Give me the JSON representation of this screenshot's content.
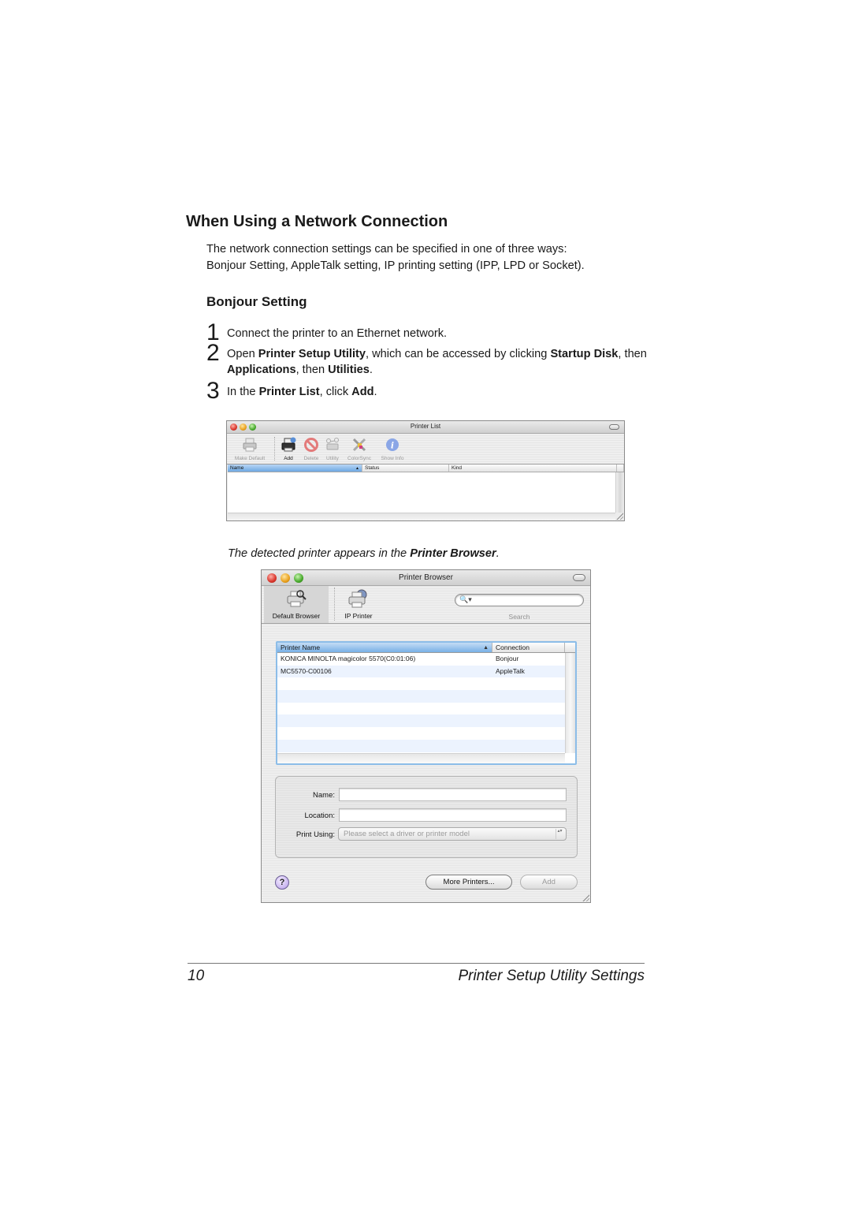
{
  "section_title": "When Using a Network Connection",
  "intro": {
    "line1": "The network connection settings can be specified in one of three ways:",
    "line2": "Bonjour Setting, AppleTalk setting, IP printing setting (IPP, LPD or Socket)."
  },
  "subsection_title": "Bonjour Setting",
  "steps": [
    {
      "num": "1",
      "parts": [
        "Connect the printer to an Ethernet network."
      ]
    },
    {
      "num": "2",
      "parts": [
        "Open ",
        "Printer Setup Utility",
        ", which can be accessed by clicking ",
        "Startup Disk",
        ", then ",
        "Applications",
        ", then ",
        "Utilities",
        "."
      ]
    },
    {
      "num": "3",
      "parts": [
        "In the ",
        "Printer List",
        ", click ",
        "Add",
        "."
      ]
    }
  ],
  "printer_list_window": {
    "title": "Printer List",
    "toolbar": [
      {
        "label": "Make Default",
        "icon": "printer-icon",
        "enabled": false
      },
      {
        "label": "Add",
        "icon": "add-printer-icon",
        "enabled": true
      },
      {
        "label": "Delete",
        "icon": "delete-icon",
        "enabled": false
      },
      {
        "label": "Utility",
        "icon": "utility-icon",
        "enabled": false
      },
      {
        "label": "ColorSync",
        "icon": "colorsync-icon",
        "enabled": false
      },
      {
        "label": "Show Info",
        "icon": "info-icon",
        "enabled": false
      }
    ],
    "columns": [
      "Name",
      "Status",
      "Kind"
    ],
    "sort_indicator": "▲"
  },
  "caption": {
    "pre": "The detected printer appears in the ",
    "bold": "Printer Browser",
    "post": "."
  },
  "printer_browser_window": {
    "title": "Printer Browser",
    "tabs": [
      {
        "label": "Default Browser",
        "icon": "default-browser-icon",
        "active": true
      },
      {
        "label": "IP Printer",
        "icon": "ip-printer-icon",
        "active": false
      }
    ],
    "search_label": "Search",
    "search_icon": "🔍▾",
    "table": {
      "columns": [
        "Printer Name",
        "Connection"
      ],
      "sort_indicator": "▲",
      "rows": [
        {
          "name": "KONICA MINOLTA magicolor 5570(C0:01:06)",
          "connection": "Bonjour"
        },
        {
          "name": "MC5570-C00106",
          "connection": "AppleTalk"
        },
        {
          "name": "",
          "connection": ""
        },
        {
          "name": "",
          "connection": ""
        },
        {
          "name": "",
          "connection": ""
        },
        {
          "name": "",
          "connection": ""
        },
        {
          "name": "",
          "connection": ""
        },
        {
          "name": "",
          "connection": ""
        },
        {
          "name": "",
          "connection": ""
        }
      ]
    },
    "form": {
      "name_label": "Name:",
      "name_value": "",
      "location_label": "Location:",
      "location_value": "",
      "print_using_label": "Print Using:",
      "print_using_value": "Please select a driver or printer model",
      "stepper": "▴▾"
    },
    "help_label": "?",
    "more_printers_label": "More Printers...",
    "add_label": "Add"
  },
  "footer": {
    "page_number": "10",
    "chapter_title": "Printer Setup Utility Settings"
  }
}
